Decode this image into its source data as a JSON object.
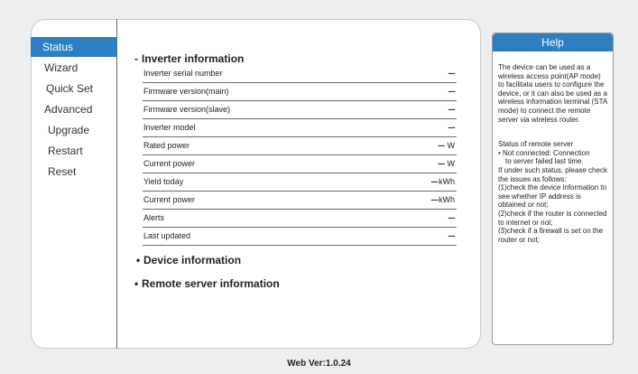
{
  "nav": {
    "items": [
      {
        "label": "Status",
        "active": true
      },
      {
        "label": "Wizard"
      },
      {
        "label": "Quick Set"
      },
      {
        "label": "Advanced"
      },
      {
        "label": "Upgrade"
      },
      {
        "label": "Restart"
      },
      {
        "label": "Reset"
      }
    ]
  },
  "main": {
    "inverter_section": {
      "bullet": "-",
      "title": "Inverter information",
      "rows": [
        {
          "label": "Inverter serial number",
          "value": "---",
          "unit": ""
        },
        {
          "label": "Firmware version(main)",
          "value": "---",
          "unit": ""
        },
        {
          "label": "Firmware version(slave)",
          "value": "---",
          "unit": ""
        },
        {
          "label": "Inverter model",
          "value": "---",
          "unit": ""
        },
        {
          "label": "Rated power",
          "value": "---",
          "unit": "W"
        },
        {
          "label": "Current power",
          "value": "---",
          "unit": "W"
        },
        {
          "label": "Yield today",
          "value": "---",
          "unit": "kWh"
        },
        {
          "label": "Current power",
          "value": "---",
          "unit": "kWh"
        },
        {
          "label": "Alerts",
          "value": "---",
          "unit": ""
        },
        {
          "label": "Last updated",
          "value": "---",
          "unit": ""
        }
      ]
    },
    "device_section": {
      "bullet": "•",
      "title": "Device information"
    },
    "remote_section": {
      "bullet": "•",
      "title": "Remote server information"
    }
  },
  "help": {
    "title": "Help",
    "intro": "The device can be used as a wireless access point(AP mode) to facilitata users to configure the device, or it can also be used as a wireless information terminal (STA mode) to connect the remote server via wireless router.",
    "status_heading": "Status of remote server",
    "status_item": "• Not connected: Connection",
    "status_item_cont": "to server failed last time.",
    "advice": "If under such status, please check the issues as follows:",
    "check1": "(1)check the device information to see whether IP address is obtained or not;",
    "check2": "(2)check if the router is connected to internet or not;",
    "check3": "(3)check if a firewall is set on the router or not;"
  },
  "footer": {
    "version": "Web Ver:1.0.24"
  },
  "colors": {
    "accent": "#2d7fc1",
    "page_bg": "#eeeeef"
  }
}
